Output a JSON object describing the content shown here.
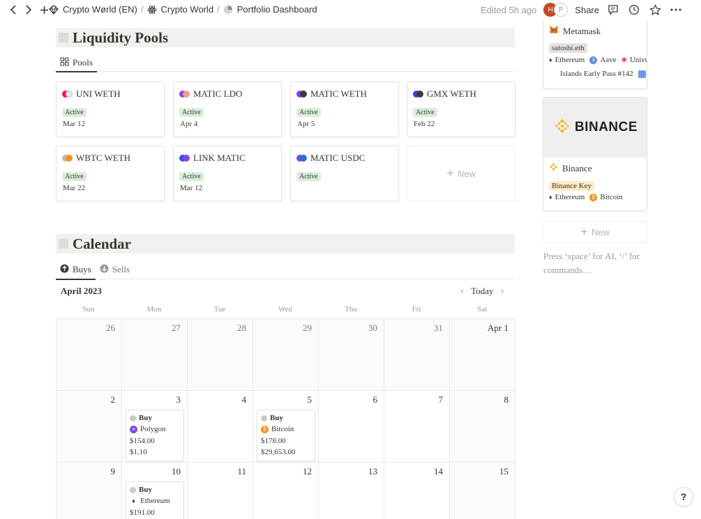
{
  "breadcrumb": {
    "items": [
      "Crypto Wørld (EN)",
      "Crypto World",
      "Portfolio Dashboard"
    ],
    "separator": "/"
  },
  "header": {
    "edited": "Edited 5h ago",
    "avatar_1": "H",
    "avatar_2": "P",
    "share_label": "Share"
  },
  "pools_section": {
    "title": "Liquidity Pools",
    "view_tab": "Pools",
    "new_label": "New",
    "cards": [
      {
        "name": "UNI WETH",
        "status": "Active",
        "date": "Mar 12"
      },
      {
        "name": "MATIC LDO",
        "status": "Active",
        "date": "Apr 4"
      },
      {
        "name": "MATIC WETH",
        "status": "Active",
        "date": "Apr 5"
      },
      {
        "name": "GMX WETH",
        "status": "Active",
        "date": "Feb 22"
      },
      {
        "name": "WBTC WETH",
        "status": "Active",
        "date": "Mar 22"
      },
      {
        "name": "LINK MATIC",
        "status": "Active",
        "date": "Mar 12"
      },
      {
        "name": "MATIC USDC",
        "status": "Active",
        "date": ""
      }
    ]
  },
  "calendar_section": {
    "title": "Calendar",
    "tabs": [
      "Buys",
      "Sells"
    ],
    "month": "April 2023",
    "today_label": "Today",
    "weekdays": [
      "Sun",
      "Mon",
      "Tue",
      "Wed",
      "Thu",
      "Fri",
      "Sat"
    ],
    "weeks": [
      [
        "26",
        "27",
        "28",
        "29",
        "30",
        "31",
        "Apr 1"
      ],
      [
        "2",
        "3",
        "4",
        "5",
        "6",
        "7",
        "8"
      ],
      [
        "9",
        "10",
        "11",
        "12",
        "13",
        "14",
        "15"
      ]
    ],
    "events": [
      {
        "type": "Buy",
        "asset": "Polygon",
        "amount": "$154.00",
        "price": "$1.10"
      },
      {
        "type": "Buy",
        "asset": "Bitcoin",
        "amount": "$178.00",
        "price": "$29,653.00"
      },
      {
        "type": "Buy",
        "asset": "Ethereum",
        "amount": "$191.00"
      }
    ]
  },
  "wallets": {
    "metamask": {
      "name": "Metamask",
      "tag": "satoshi.eth",
      "chains": [
        "Ethereum",
        "Aave",
        "Unisv"
      ],
      "extra": "Islands Early Pass #142",
      "extra_tail": "v"
    },
    "binance": {
      "logo_text": "BINANCE",
      "name": "Binance",
      "tag": "Binance Key",
      "chains": [
        "Ethereum",
        "Bitcoin"
      ]
    },
    "new_label": "New"
  },
  "editor": {
    "placeholder": "Press ‘space’ for AI, ‘/’ for commands…"
  },
  "help_label": "?",
  "colors": {
    "badge_active_bg": "#dbeddb",
    "binance_yellow": "#f0b90b",
    "bitcoin_orange": "#f7931a",
    "polygon_purple": "#8247e5",
    "avatar_red": "#c44a2a"
  }
}
